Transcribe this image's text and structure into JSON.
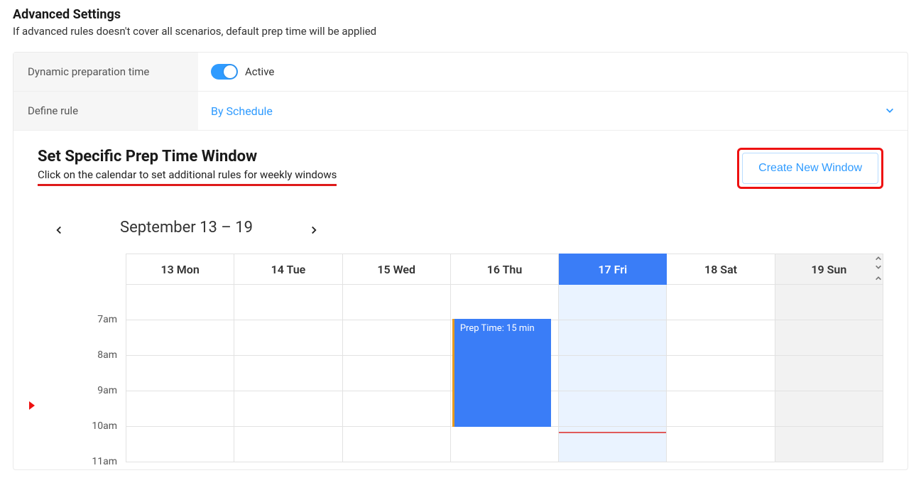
{
  "heading": {
    "title": "Advanced Settings",
    "subtitle": "If advanced rules doesn't cover all scenarios, default prep time will be applied"
  },
  "rows": {
    "dyn_label": "Dynamic preparation time",
    "dyn_status": "Active",
    "rule_label": "Define rule",
    "rule_value": "By Schedule"
  },
  "section": {
    "title": "Set Specific Prep Time Window",
    "subtitle": "Click on the calendar to set additional rules for weekly windows",
    "button": "Create New Window"
  },
  "calendar": {
    "range": "September 13 – 19",
    "days": [
      {
        "label": "13 Mon",
        "today": false
      },
      {
        "label": "14 Tue",
        "today": false
      },
      {
        "label": "15 Wed",
        "today": false
      },
      {
        "label": "16 Thu",
        "today": false,
        "event": "Prep Time: 15 min"
      },
      {
        "label": "17 Fri",
        "today": true
      },
      {
        "label": "18 Sat",
        "today": false
      },
      {
        "label": "19 Sun",
        "today": false,
        "muted": true
      }
    ],
    "hours": [
      "7am",
      "8am",
      "9am",
      "10am",
      "11am"
    ]
  }
}
